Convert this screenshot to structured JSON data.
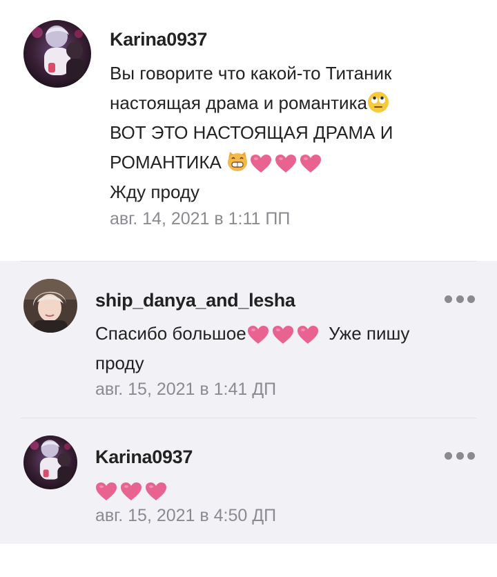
{
  "comments": [
    {
      "username": "Karina0937",
      "lines": [
        "Вы говорите что какой-то Титаник",
        "настоящая драма и романтика",
        "ВОТ ЭТО НАСТОЯЩАЯ ДРАМА И",
        "РОМАНТИКА",
        "Жду проду"
      ],
      "date": "авг. 14, 2021 в 1:11 ПП",
      "avatar_icon": "user-avatar-photo",
      "emojis": [
        "face-with-rolling-eyes-icon",
        "grinning-cat-icon",
        "heart-icon"
      ]
    },
    {
      "username": "ship_danya_and_lesha",
      "lines": [
        "Спасибо большое",
        "Уже пишу",
        "проду"
      ],
      "date": "авг. 15, 2021 в 1:41 ДП",
      "avatar_icon": "user-avatar-photo",
      "more_icon": "more-options-icon"
    },
    {
      "username": "Karina0937",
      "lines": [],
      "date": "авг. 15, 2021 в 4:50 ДП",
      "avatar_icon": "user-avatar-photo",
      "more_icon": "more-options-icon"
    }
  ],
  "colors": {
    "heart": "#e8638f",
    "reply_bg": "#f2f1f5",
    "date": "#8a8a90"
  }
}
